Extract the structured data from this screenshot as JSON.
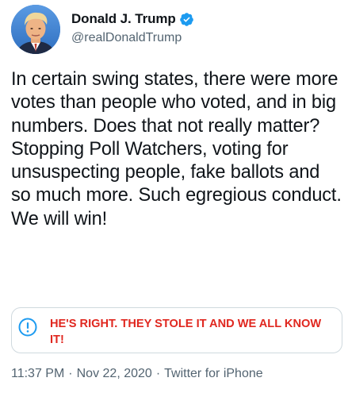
{
  "author": {
    "display_name": "Donald J. Trump",
    "handle": "@realDonaldTrump",
    "verified_icon": "verified-badge-icon",
    "avatar_icon": "profile-photo"
  },
  "tweet": {
    "text": "In certain swing states, there were more votes than people who voted, and in big numbers. Does that not really matter? Stopping Poll Watchers, voting for unsuspecting people, fake ballots and so much more. Such egregious conduct. We will win!"
  },
  "notice": {
    "icon": "exclamation-circle-icon",
    "text": "HE'S RIGHT. THEY STOLE IT AND WE ALL KNOW IT!",
    "color": "#e0271f"
  },
  "meta": {
    "time": "11:37 PM",
    "date": "Nov 22, 2020",
    "source": "Twitter for iPhone",
    "separator": "·"
  },
  "colors": {
    "text": "#0f1419",
    "secondary": "#536471",
    "verified_blue": "#1d9bf0",
    "border": "#cfd9de"
  }
}
